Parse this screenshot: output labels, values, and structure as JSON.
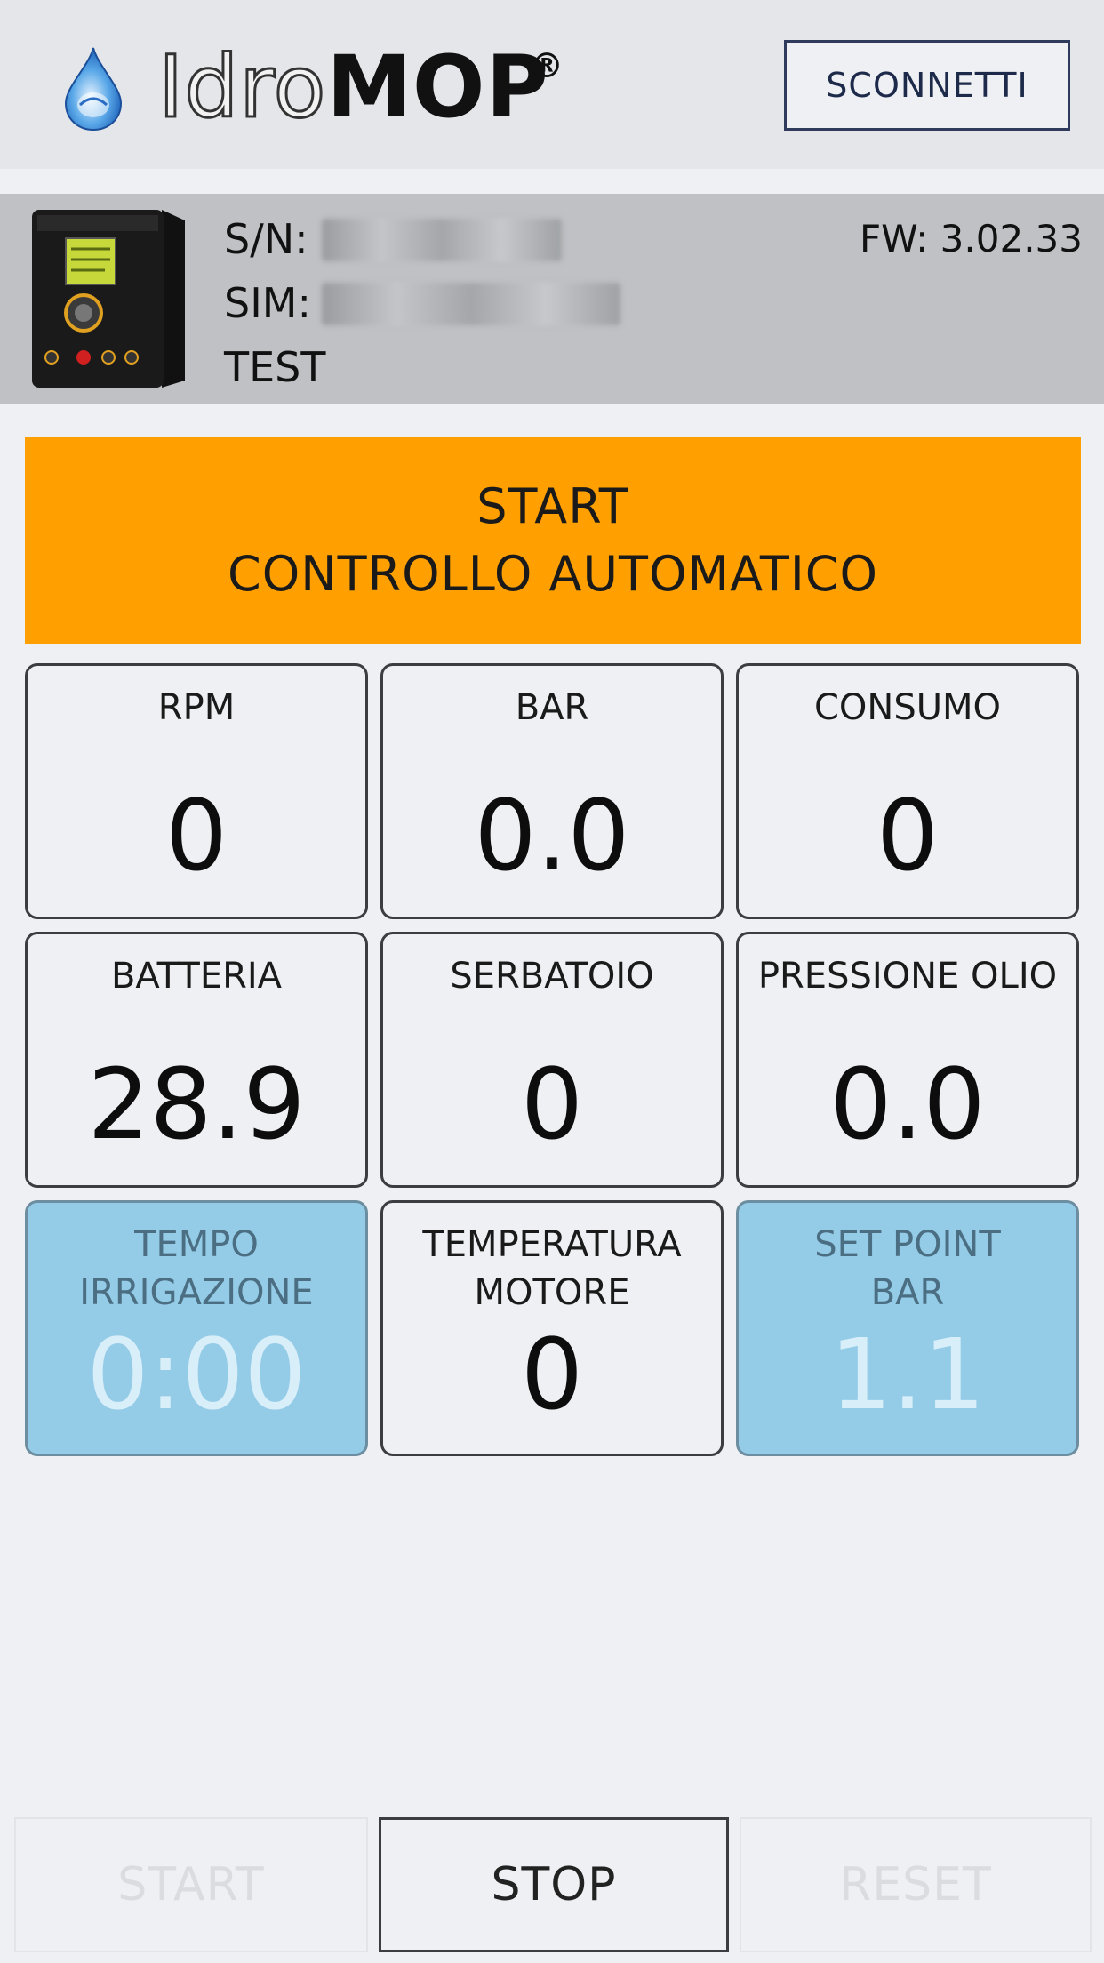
{
  "header": {
    "logo_light": "Idro",
    "logo_bold": "MOP",
    "logo_mark": "®",
    "disconnect_label": "SCONNETTI"
  },
  "device": {
    "sn_label": "S/N:",
    "sim_label": "SIM:",
    "name": "TEST",
    "fw_label": "FW: 3.02.33"
  },
  "auto_control": {
    "line1": "START",
    "line2": "CONTROLLO AUTOMATICO"
  },
  "tiles": [
    {
      "label": "RPM",
      "value": "0"
    },
    {
      "label": "BAR",
      "value": "0.0"
    },
    {
      "label": "CONSUMO",
      "value": "0"
    },
    {
      "label": "BATTERIA",
      "value": "28.9"
    },
    {
      "label": "SERBATOIO",
      "value": "0"
    },
    {
      "label": "PRESSIONE OLIO",
      "value": "0.0"
    },
    {
      "label": "TEMPO",
      "label2": "IRRIGAZIONE",
      "value": "0:00"
    },
    {
      "label": "TEMPERATURA",
      "label2": "MOTORE",
      "value": "0"
    },
    {
      "label": "SET POINT",
      "label2": "BAR",
      "value": "1.1"
    }
  ],
  "footer": {
    "start_label": "START",
    "stop_label": "STOP",
    "reset_label": "RESET"
  },
  "colors": {
    "accent_orange": "#ffa000",
    "tile_blue": "#94cce8",
    "header_bg": "#e4e6e9",
    "device_bar_bg": "#bfc1c4"
  }
}
